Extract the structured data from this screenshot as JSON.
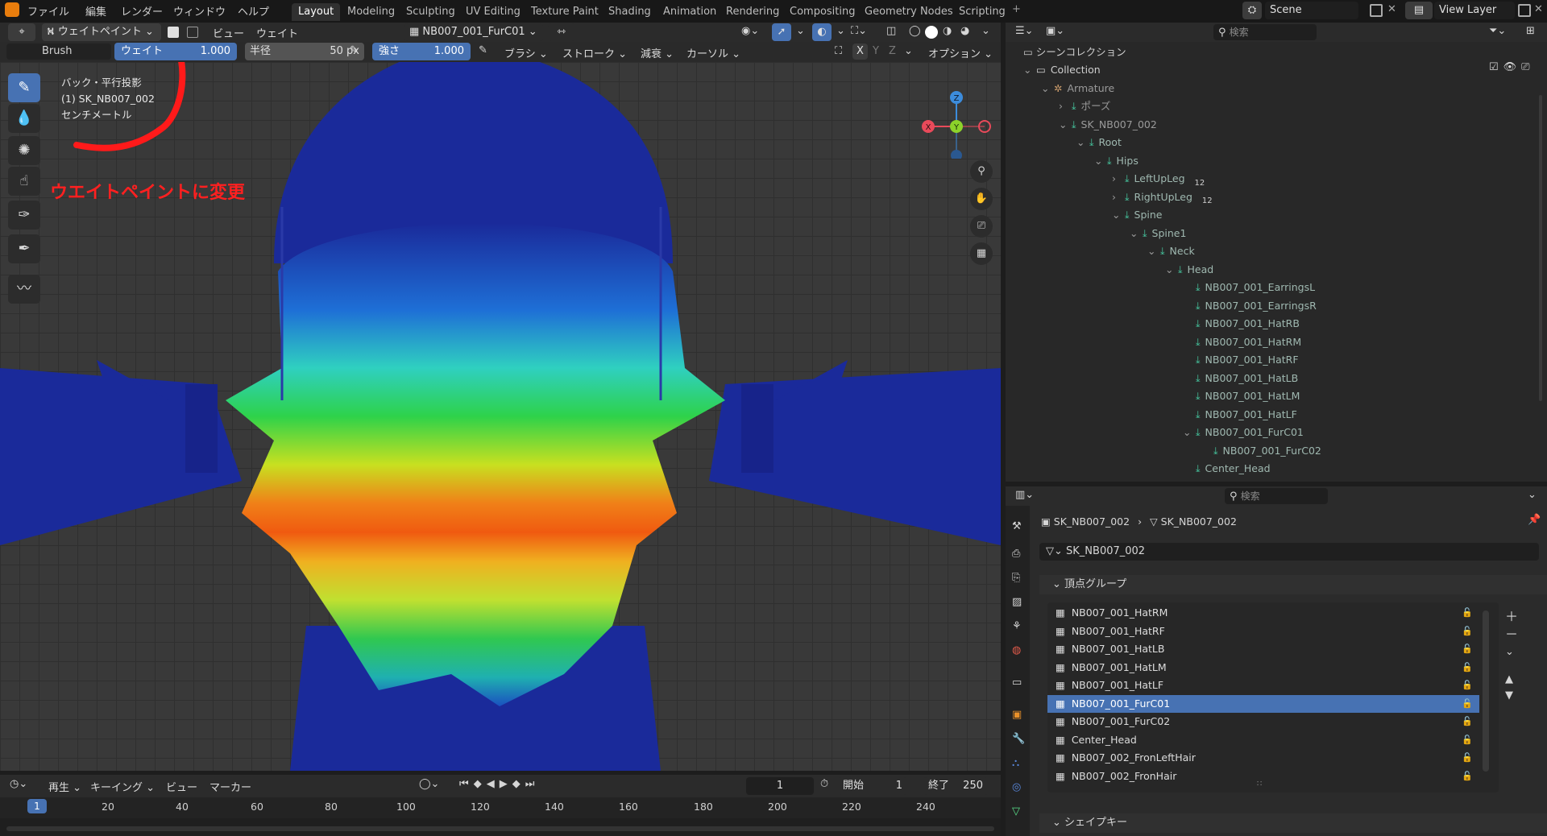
{
  "menubar": {
    "menus": [
      "ファイル",
      "編集",
      "レンダー",
      "ウィンドウ",
      "ヘルプ"
    ],
    "workspaces": [
      "Layout",
      "Modeling",
      "Sculpting",
      "UV Editing",
      "Texture Paint",
      "Shading",
      "Animation",
      "Rendering",
      "Compositing",
      "Geometry Nodes",
      "Scripting"
    ],
    "active_workspace": "Layout",
    "add_tab": "+",
    "scene_name": "Scene",
    "view_layer": "View Layer"
  },
  "viewport_header": {
    "mode": "ウェイトペイント",
    "view_menu": "ビュー",
    "weights_menu": "ウェイト",
    "active_group": "NB007_001_FurC01",
    "brush_label": "Brush",
    "weight_label": "ウェイト",
    "weight_value": "1.000",
    "radius_label": "半径",
    "radius_value": "50 px",
    "strength_label": "強さ",
    "strength_value": "1.000",
    "brush_menu": "ブラシ",
    "stroke_menu": "ストローク",
    "falloff_menu": "減衰",
    "cursor_menu": "カーソル",
    "options_menu": "オプション",
    "axes": [
      "X",
      "Y",
      "Z"
    ]
  },
  "viewport": {
    "info_lines": [
      "バック・平行投影",
      "(1) SK_NB007_002",
      "センチメートル"
    ],
    "annotation": "ウエイトペイントに変更",
    "gizmo_axes": [
      "Z",
      "X",
      "Y"
    ]
  },
  "outliner": {
    "search_placeholder": "検索",
    "scene_collection": "シーンコレクション",
    "rows": [
      {
        "label": "Collection",
        "depth": 0,
        "type": "collection",
        "expanded": true
      },
      {
        "label": "Armature",
        "depth": 1,
        "type": "armature",
        "expanded": true
      },
      {
        "label": "ポーズ",
        "depth": 2,
        "type": "pose",
        "expanded": false
      },
      {
        "label": "SK_NB007_002",
        "depth": 2,
        "type": "armature-data",
        "expanded": true
      },
      {
        "label": "Root",
        "depth": 3,
        "type": "bone",
        "expanded": true
      },
      {
        "label": "Hips",
        "depth": 4,
        "type": "bone",
        "expanded": true
      },
      {
        "label": "LeftUpLeg",
        "depth": 5,
        "type": "bone",
        "expanded": false,
        "badge": "12"
      },
      {
        "label": "RightUpLeg",
        "depth": 5,
        "type": "bone",
        "expanded": false,
        "badge": "12"
      },
      {
        "label": "Spine",
        "depth": 5,
        "type": "bone",
        "expanded": true
      },
      {
        "label": "Spine1",
        "depth": 6,
        "type": "bone",
        "expanded": true
      },
      {
        "label": "Neck",
        "depth": 7,
        "type": "bone",
        "expanded": true
      },
      {
        "label": "Head",
        "depth": 8,
        "type": "bone",
        "expanded": true
      },
      {
        "label": "NB007_001_EarringsL",
        "depth": 9,
        "type": "bone"
      },
      {
        "label": "NB007_001_EarringsR",
        "depth": 9,
        "type": "bone"
      },
      {
        "label": "NB007_001_HatRB",
        "depth": 9,
        "type": "bone"
      },
      {
        "label": "NB007_001_HatRM",
        "depth": 9,
        "type": "bone"
      },
      {
        "label": "NB007_001_HatRF",
        "depth": 9,
        "type": "bone"
      },
      {
        "label": "NB007_001_HatLB",
        "depth": 9,
        "type": "bone"
      },
      {
        "label": "NB007_001_HatLM",
        "depth": 9,
        "type": "bone"
      },
      {
        "label": "NB007_001_HatLF",
        "depth": 9,
        "type": "bone"
      },
      {
        "label": "NB007_001_FurC01",
        "depth": 9,
        "type": "bone",
        "expanded": true
      },
      {
        "label": "NB007_001_FurC02",
        "depth": 10,
        "type": "bone"
      },
      {
        "label": "Center_Head",
        "depth": 9,
        "type": "bone"
      }
    ]
  },
  "properties": {
    "search_placeholder": "検索",
    "breadcrumb": [
      "SK_NB007_002",
      "SK_NB007_002"
    ],
    "mesh_name": "SK_NB007_002",
    "vertex_groups_title": "頂点グループ",
    "vertex_groups": [
      "NB007_001_HatRM",
      "NB007_001_HatRF",
      "NB007_001_HatLB",
      "NB007_001_HatLM",
      "NB007_001_HatLF",
      "NB007_001_FurC01",
      "NB007_001_FurC02",
      "Center_Head",
      "NB007_002_FronLeftHair",
      "NB007_002_FronHair"
    ],
    "active_vertex_group": "NB007_001_FurC01",
    "shape_keys_title": "シェイプキー"
  },
  "timeline": {
    "play_menu": "再生",
    "keying_menu": "キーイング",
    "view_menu": "ビュー",
    "marker_menu": "マーカー",
    "current_frame": "1",
    "start_label": "開始",
    "start_value": "1",
    "end_label": "終了",
    "end_value": "250",
    "ruler_ticks": [
      "1",
      "20",
      "40",
      "60",
      "80",
      "100",
      "120",
      "140",
      "160",
      "180",
      "200",
      "220",
      "240"
    ]
  },
  "colors": {
    "accent": "#4772b3",
    "annotation_red": "#ff2020",
    "mesh_blue": "#1a2a9a",
    "bone_green": "#46c8a0"
  }
}
